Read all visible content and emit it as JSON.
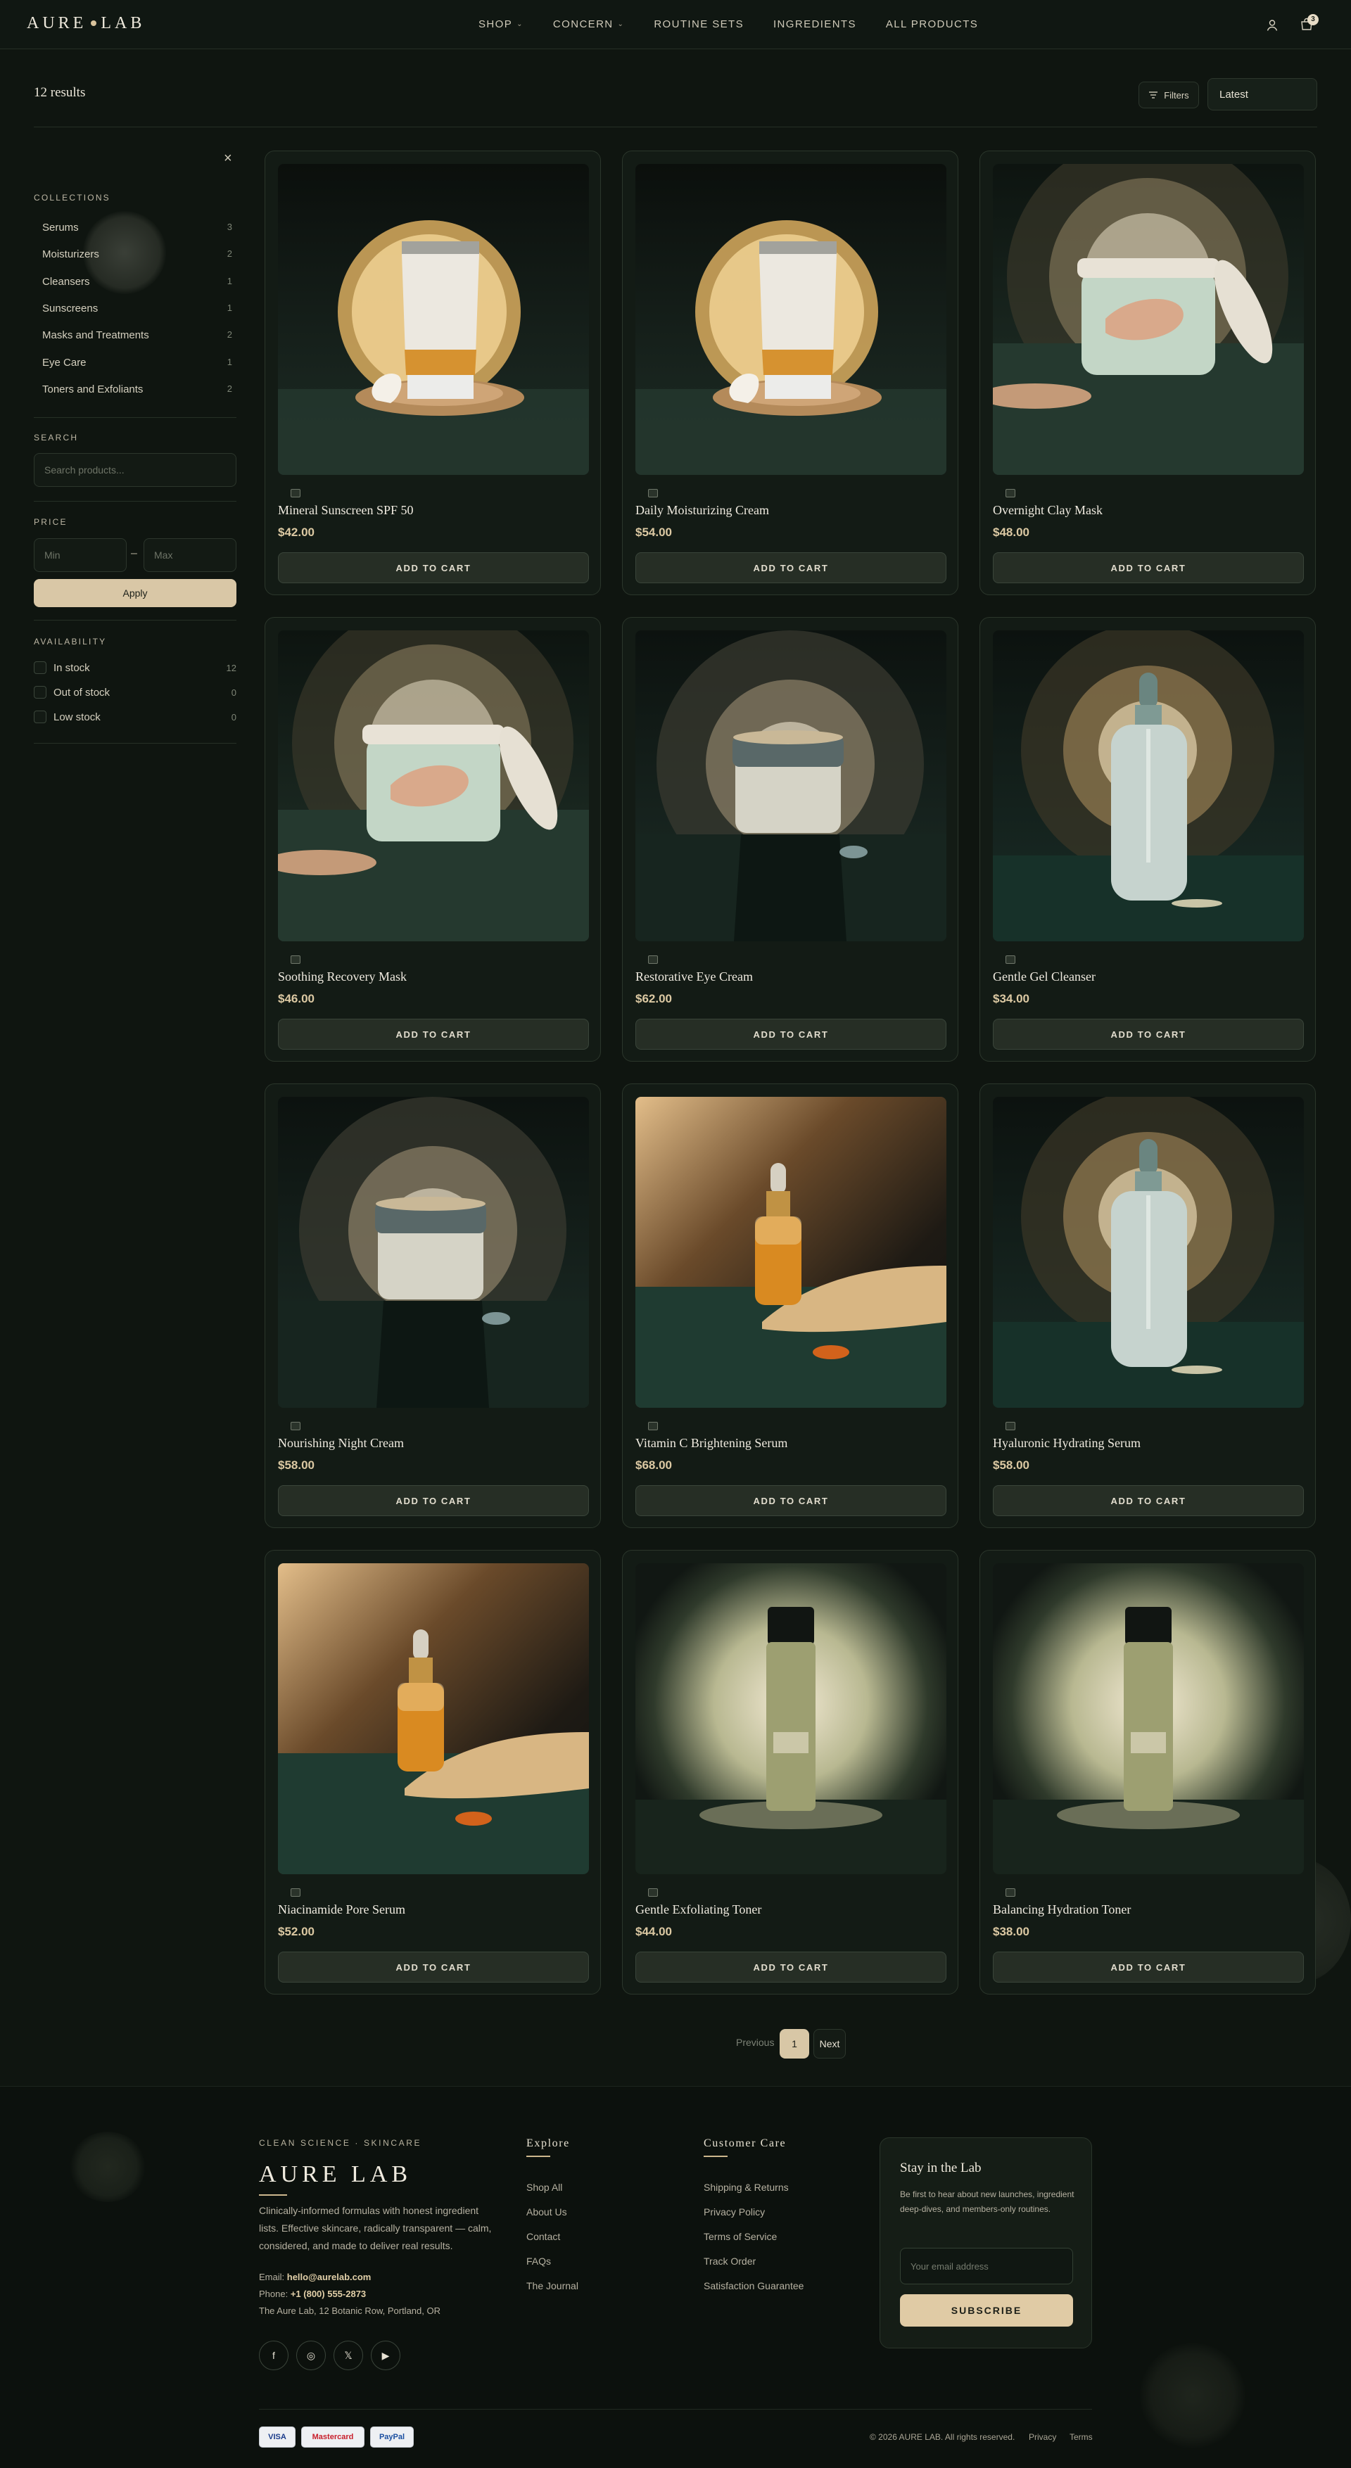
{
  "header": {
    "logo_left": "AURE",
    "logo_right": "LAB",
    "nav": [
      {
        "label": "SHOP",
        "dropdown": true
      },
      {
        "label": "CONCERN",
        "dropdown": true
      },
      {
        "label": "ROUTINE SETS",
        "dropdown": false
      },
      {
        "label": "INGREDIENTS",
        "dropdown": false
      },
      {
        "label": "ALL PRODUCTS",
        "dropdown": false
      }
    ],
    "cart_count": "3"
  },
  "toolbar": {
    "results": "12 results",
    "filters_label": "Filters",
    "sort_value": "Latest"
  },
  "sidebar": {
    "close": "×",
    "collections_heading": "COLLECTIONS",
    "collections": [
      {
        "label": "Serums",
        "count": "3"
      },
      {
        "label": "Moisturizers",
        "count": "2"
      },
      {
        "label": "Cleansers",
        "count": "1"
      },
      {
        "label": "Sunscreens",
        "count": "1"
      },
      {
        "label": "Masks and Treatments",
        "count": "2"
      },
      {
        "label": "Eye Care",
        "count": "1"
      },
      {
        "label": "Toners and Exfoliants",
        "count": "2"
      }
    ],
    "search_heading": "SEARCH",
    "search_placeholder": "Search products...",
    "price_heading": "PRICE",
    "price_min_placeholder": "Min",
    "price_max_placeholder": "Max",
    "price_separator": "–",
    "apply_label": "Apply",
    "availability_heading": "AVAILABILITY",
    "availability": [
      {
        "label": "In stock",
        "count": "12"
      },
      {
        "label": "Out of stock",
        "count": "0"
      },
      {
        "label": "Low stock",
        "count": "0"
      }
    ]
  },
  "products": [
    {
      "name": "Mineral Sunscreen SPF 50",
      "price": "$42.00",
      "image": "tube"
    },
    {
      "name": "Daily Moisturizing Cream",
      "price": "$54.00",
      "image": "tube"
    },
    {
      "name": "Overnight Clay Mask",
      "price": "$48.00",
      "image": "mint-jar"
    },
    {
      "name": "Soothing Recovery Mask",
      "price": "$46.00",
      "image": "mint-jar"
    },
    {
      "name": "Restorative Eye Cream",
      "price": "$62.00",
      "image": "frosted-jar"
    },
    {
      "name": "Gentle Gel Cleanser",
      "price": "$34.00",
      "image": "clear-dropper"
    },
    {
      "name": "Nourishing Night Cream",
      "price": "$58.00",
      "image": "frosted-jar"
    },
    {
      "name": "Vitamin C Brightening Serum",
      "price": "$68.00",
      "image": "amber-dropper"
    },
    {
      "name": "Hyaluronic Hydrating Serum",
      "price": "$58.00",
      "image": "clear-dropper"
    },
    {
      "name": "Niacinamide Pore Serum",
      "price": "$52.00",
      "image": "amber-dropper"
    },
    {
      "name": "Gentle Exfoliating Toner",
      "price": "$44.00",
      "image": "toner-bottle"
    },
    {
      "name": "Balancing Hydration Toner",
      "price": "$38.00",
      "image": "toner-bottle"
    }
  ],
  "product_button_label": "ADD TO CART",
  "pagination": {
    "prev": "Previous",
    "current": "1",
    "next": "Next"
  },
  "footer": {
    "eyebrow": "CLEAN SCIENCE · SKINCARE",
    "logo": "AURE LAB",
    "description": "Clinically-informed formulas with honest ingredient lists. Effective skincare, radically transparent — calm, considered, and made to deliver real results.",
    "email_label": "Email:",
    "email": "hello@aurelab.com",
    "phone_label": "Phone:",
    "phone": "+1 (800) 555-2873",
    "address": "The Aure Lab, 12 Botanic Row, Portland, OR",
    "social": [
      "f",
      "◎",
      "𝕏",
      "▶"
    ],
    "explore_title": "Explore",
    "explore_links": [
      "Shop All",
      "About Us",
      "Contact",
      "FAQs",
      "The Journal"
    ],
    "care_title": "Customer Care",
    "care_links": [
      "Shipping & Returns",
      "Privacy Policy",
      "Terms of Service",
      "Track Order",
      "Satisfaction Guarantee"
    ],
    "newsletter": {
      "title": "Stay in the Lab",
      "description": "Be first to hear about new launches, ingredient deep-dives, and members-only routines.",
      "placeholder": "Your email address",
      "button": "SUBSCRIBE"
    },
    "payments": [
      {
        "label": "VISA",
        "color": "#1a3b8a"
      },
      {
        "label": "Mastercard",
        "color": "#c8202c"
      },
      {
        "label": "PayPal",
        "color": "#1b4fa0"
      }
    ],
    "copyright": "© 2026 AURE LAB. All rights reserved.",
    "privacy": "Privacy",
    "terms": "Terms"
  }
}
